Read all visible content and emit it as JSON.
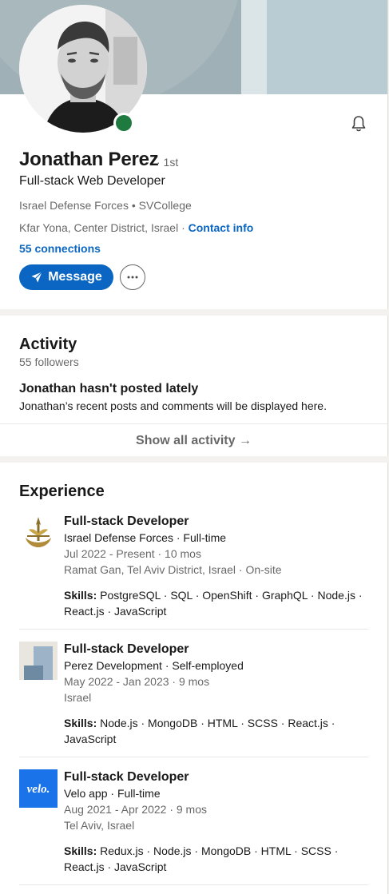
{
  "profile": {
    "name": "Jonathan Perez",
    "degree": "· 1st",
    "headline": "Full-stack Web Developer",
    "orgs": "Israel Defense Forces • SVCollege",
    "location": "Kfar Yona, Center District, Israel · ",
    "contact_info": "Contact info",
    "connections": "55 connections",
    "message_label": "Message",
    "more_label": "···",
    "online_color": "#1f7a3f",
    "accent_color": "#0a66c2"
  },
  "activity": {
    "title": "Activity",
    "followers": "55 followers",
    "empty_title": "Jonathan hasn't posted lately",
    "empty_desc": "Jonathan’s recent posts and comments will be displayed here.",
    "show_all": "Show all activity →"
  },
  "experience": {
    "title": "Experience",
    "skills_label": "Skills:",
    "items": [
      {
        "title": "Full-stack Developer",
        "company": "Israel Defense Forces · Full-time",
        "dates": "Jul 2022 - Present · 10 mos",
        "location": "Ramat Gan, Tel Aviv District, Israel · On-site",
        "skills_1": "PostgreSQL · SQL · OpenShift · GraphQL · Node.js ·",
        "skills_2": "React.js · JavaScript"
      },
      {
        "title": "Full-stack Developer",
        "company": "Perez Development · Self-employed",
        "dates": "May 2022 - Jan 2023 · 9 mos",
        "location": "Israel",
        "skills_1": "Node.js · MongoDB · HTML · SCSS · React.js ·",
        "skills_2": "JavaScript"
      },
      {
        "title": "Full-stack Developer",
        "company": "Velo app · Full-time",
        "dates": "Aug 2021 - Apr 2022 · 9 mos",
        "location": "Tel Aviv, Israel",
        "skills_1": "Redux.js · Node.js · MongoDB · HTML · SCSS ·",
        "skills_2": "React.js · JavaScript",
        "logo_text": "velo."
      }
    ]
  }
}
